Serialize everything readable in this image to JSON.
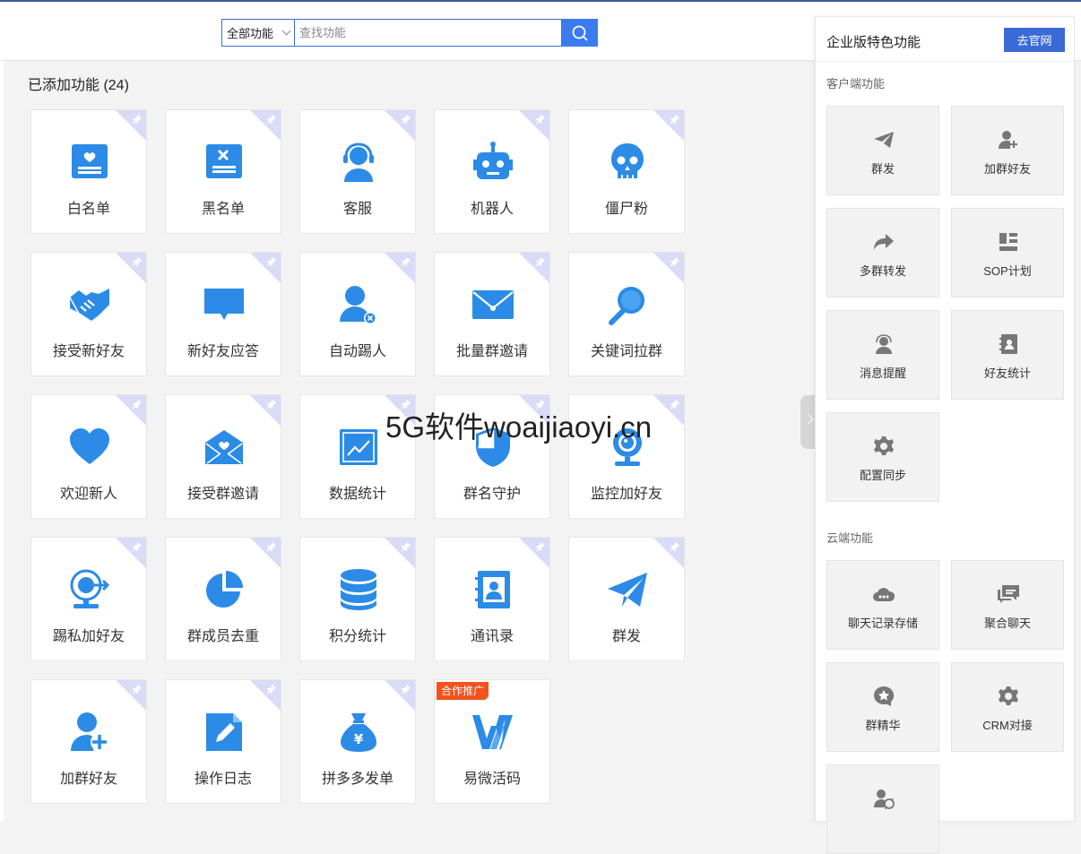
{
  "search": {
    "scope": "全部功能",
    "placeholder": "查找功能"
  },
  "added": {
    "title": "已添加功能 (24)",
    "items": [
      {
        "label": "白名单",
        "icon": "whitelist-icon"
      },
      {
        "label": "黑名单",
        "icon": "blacklist-icon"
      },
      {
        "label": "客服",
        "icon": "customer-service-icon"
      },
      {
        "label": "机器人",
        "icon": "robot-icon"
      },
      {
        "label": "僵尸粉",
        "icon": "skull-icon"
      },
      {
        "label": "接受新好友",
        "icon": "handshake-icon"
      },
      {
        "label": "新好友应答",
        "icon": "chat-bubble-icon"
      },
      {
        "label": "自动踢人",
        "icon": "user-remove-icon"
      },
      {
        "label": "批量群邀请",
        "icon": "envelope-icon"
      },
      {
        "label": "关键词拉群",
        "icon": "magnifier-icon"
      },
      {
        "label": "欢迎新人",
        "icon": "heart-icon"
      },
      {
        "label": "接受群邀请",
        "icon": "open-envelope-icon"
      },
      {
        "label": "数据统计",
        "icon": "line-chart-icon"
      },
      {
        "label": "群名守护",
        "icon": "shield-icon"
      },
      {
        "label": "监控加好友",
        "icon": "webcam-icon"
      },
      {
        "label": "踢私加好友",
        "icon": "webcam-arrow-icon"
      },
      {
        "label": "群成员去重",
        "icon": "pie-chart-icon"
      },
      {
        "label": "积分统计",
        "icon": "database-icon"
      },
      {
        "label": "通讯录",
        "icon": "contacts-icon"
      },
      {
        "label": "群发",
        "icon": "paper-plane-icon"
      },
      {
        "label": "加群好友",
        "icon": "user-add-icon"
      },
      {
        "label": "操作日志",
        "icon": "document-edit-icon"
      },
      {
        "label": "拼多多发单",
        "icon": "money-bag-icon"
      },
      {
        "label": "易微活码",
        "icon": "yiwei-logo-icon",
        "badge": "合作推广"
      }
    ]
  },
  "watermark": "5G软件woaijiaoyi.cn",
  "panel": {
    "title": "企业版特色功能",
    "go_label": "去官网",
    "client_section": "客户端功能",
    "client_items": [
      {
        "label": "群发",
        "icon": "paper-plane-icon"
      },
      {
        "label": "加群好友",
        "icon": "user-add-icon"
      },
      {
        "label": "多群转发",
        "icon": "forward-arrow-icon"
      },
      {
        "label": "SOP计划",
        "icon": "layout-plan-icon"
      },
      {
        "label": "消息提醒",
        "icon": "headset-user-icon"
      },
      {
        "label": "好友统计",
        "icon": "contacts-icon"
      },
      {
        "label": "配置同步",
        "icon": "gear-icon"
      }
    ],
    "cloud_section": "云端功能",
    "cloud_items": [
      {
        "label": "聊天记录存储",
        "icon": "cloud-chat-icon"
      },
      {
        "label": "聚合聊天",
        "icon": "chat-bubbles-icon"
      },
      {
        "label": "群精华",
        "icon": "star-bubble-icon"
      },
      {
        "label": "CRM对接",
        "icon": "gear-icon"
      },
      {
        "label": "",
        "icon": "user-sync-icon"
      }
    ]
  },
  "colors": {
    "accent": "#3a7bf0",
    "icon_blue": "#2b8be6",
    "badge": "#f3521d",
    "pin_corner": "#d9dcf6",
    "panel_icon": "#777777"
  }
}
